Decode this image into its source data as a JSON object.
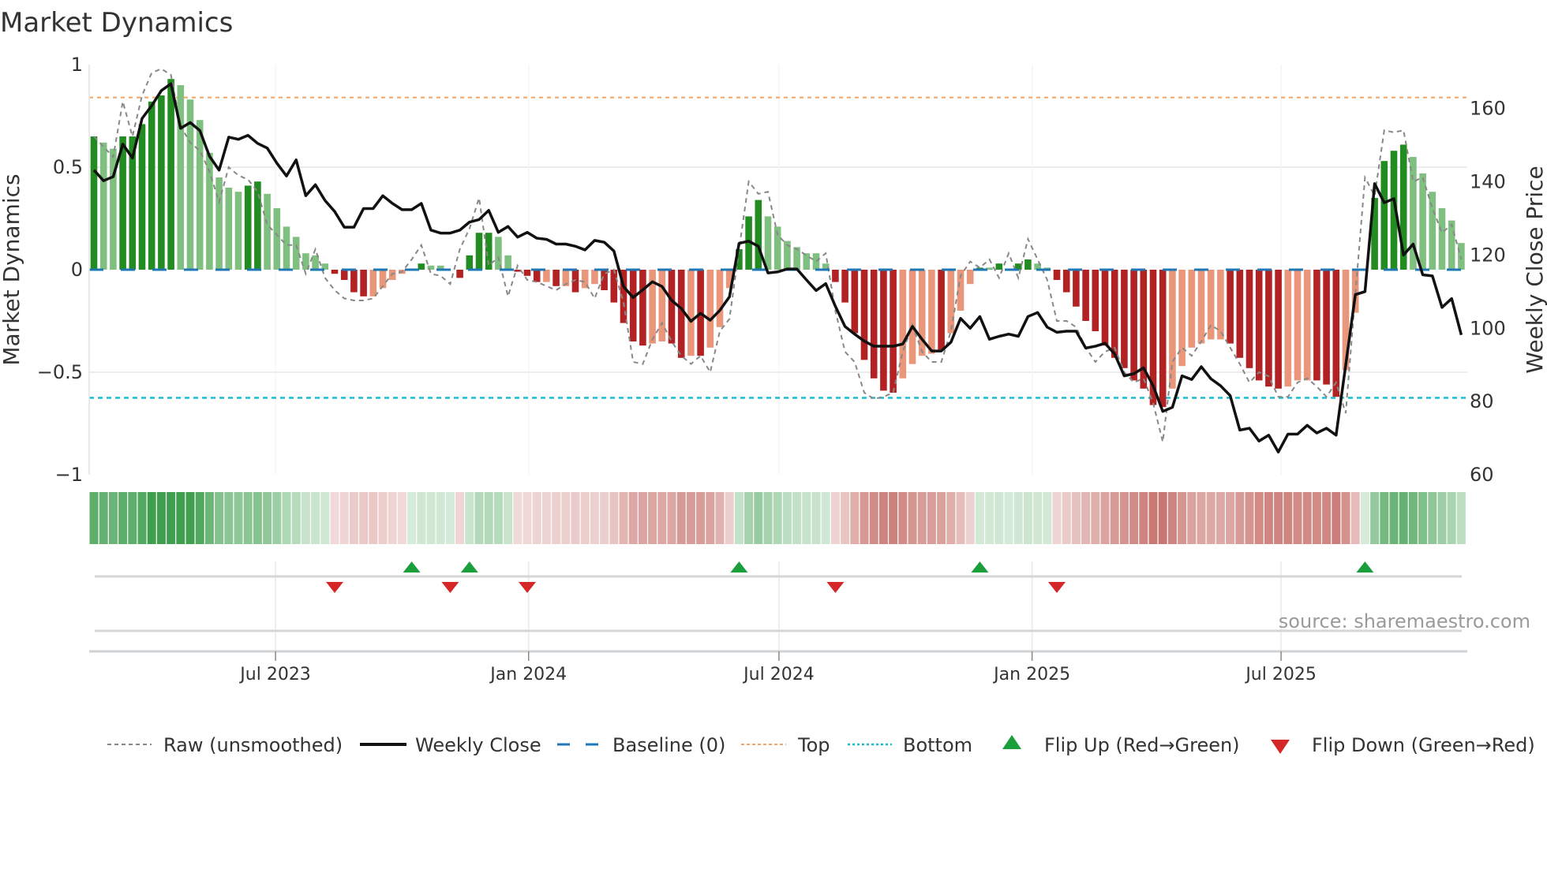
{
  "title": "Market Dynamics",
  "source": "source: sharemaestro.com",
  "chart_data": {
    "type": "bar",
    "title": "Market Dynamics",
    "ylabel": "Market Dynamics",
    "y2label": "Weekly Close Price",
    "ylim": [
      -1,
      1
    ],
    "y2lim": [
      60,
      172
    ],
    "yticks": [
      {
        "v": 1,
        "label": "1"
      },
      {
        "v": 0.5,
        "label": "0.5"
      },
      {
        "v": 0,
        "label": "0"
      },
      {
        "v": -0.5,
        "label": "−0.5"
      },
      {
        "v": -1,
        "label": "−1"
      }
    ],
    "y2ticks": [
      {
        "v": 160,
        "label": "160"
      },
      {
        "v": 140,
        "label": "140"
      },
      {
        "v": 120,
        "label": "120"
      },
      {
        "v": 100,
        "label": "100"
      },
      {
        "v": 80,
        "label": "80"
      },
      {
        "v": 60,
        "label": "60"
      }
    ],
    "x_start": "2023-02-19",
    "x_step_days": 7,
    "xticks": [
      {
        "date": "2023-07-01",
        "label": "Jul 2023"
      },
      {
        "date": "2024-01-01",
        "label": "Jan 2024"
      },
      {
        "date": "2024-07-01",
        "label": "Jul 2024"
      },
      {
        "date": "2025-01-01",
        "label": "Jan 2025"
      },
      {
        "date": "2025-07-01",
        "label": "Jul 2025"
      }
    ],
    "levels": {
      "baseline": 0,
      "top": 0.84,
      "bottom": -0.625
    },
    "series": [
      {
        "name": "Market Dynamics",
        "values": [
          0.65,
          0.62,
          0.59,
          0.65,
          0.65,
          0.71,
          0.82,
          0.85,
          0.93,
          0.9,
          0.83,
          0.73,
          0.57,
          0.45,
          0.4,
          0.38,
          0.41,
          0.43,
          0.37,
          0.3,
          0.21,
          0.16,
          0.08,
          0.07,
          0.03,
          -0.02,
          -0.05,
          -0.11,
          -0.13,
          -0.13,
          -0.09,
          -0.05,
          -0.02,
          0,
          0.03,
          0.02,
          0.02,
          0,
          -0.04,
          0.07,
          0.18,
          0.18,
          0.16,
          0.07,
          -0.01,
          -0.03,
          -0.06,
          -0.06,
          -0.08,
          -0.08,
          -0.11,
          -0.09,
          -0.07,
          -0.1,
          -0.16,
          -0.26,
          -0.35,
          -0.37,
          -0.36,
          -0.35,
          -0.36,
          -0.43,
          -0.42,
          -0.42,
          -0.38,
          -0.28,
          -0.09,
          0.1,
          0.26,
          0.34,
          0.26,
          0.21,
          0.14,
          0.11,
          0.08,
          0.08,
          0.03,
          -0.06,
          -0.16,
          -0.31,
          -0.44,
          -0.53,
          -0.59,
          -0.6,
          -0.53,
          -0.46,
          -0.42,
          -0.41,
          -0.39,
          -0.31,
          -0.2,
          -0.07,
          0.01,
          0.01,
          0.03,
          0,
          0.03,
          0.05,
          0.03,
          0.01,
          -0.05,
          -0.11,
          -0.18,
          -0.25,
          -0.3,
          -0.37,
          -0.43,
          -0.48,
          -0.54,
          -0.58,
          -0.66,
          -0.67,
          -0.58,
          -0.47,
          -0.38,
          -0.36,
          -0.34,
          -0.34,
          -0.36,
          -0.43,
          -0.48,
          -0.54,
          -0.57,
          -0.58,
          -0.57,
          -0.54,
          -0.54,
          -0.54,
          -0.56,
          -0.62,
          -0.49,
          -0.21,
          0,
          0.35,
          0.53,
          0.58,
          0.61,
          0.55,
          0.47,
          0.38,
          0.3,
          0.24,
          0.13
        ],
        "shade": "DLLDDDDDDLLLLLLLDDLLLLLLLDDDDLLLLLDLLLDDDDLLDDDLDLDLLDDDDDLLDDLDLLLDDDLLLLLLLDDDDDDDLLLLDLLLDLDLDDLLDDDDDDDDDDDDLLLLLLDDDDDDLLLDDDLLLDDDDLLLLLL"
      },
      {
        "name": "Raw (unsmoothed)",
        "values": [
          0.65,
          0.6,
          0.55,
          0.82,
          0.65,
          0.85,
          0.96,
          0.98,
          0.95,
          0.7,
          0.62,
          0.58,
          0.48,
          0.33,
          0.5,
          0.46,
          0.44,
          0.38,
          0.22,
          0.17,
          0.12,
          0.12,
          -0.02,
          0.1,
          -0.04,
          -0.1,
          -0.14,
          -0.15,
          -0.15,
          -0.14,
          -0.08,
          -0.02,
          -0.01,
          0.05,
          0.12,
          -0.02,
          -0.03,
          -0.07,
          0.1,
          0.2,
          0.35,
          0.02,
          0.06,
          -0.13,
          0.02,
          -0.05,
          -0.06,
          -0.08,
          -0.1,
          -0.07,
          -0.05,
          -0.06,
          -0.14,
          -0.02,
          0,
          -0.16,
          -0.45,
          -0.46,
          -0.34,
          -0.26,
          -0.35,
          -0.42,
          -0.46,
          -0.42,
          -0.5,
          -0.3,
          -0.24,
          0.1,
          0.43,
          0.37,
          0.38,
          0.17,
          0.12,
          0.1,
          0.07,
          0.04,
          0.08,
          -0.2,
          -0.4,
          -0.45,
          -0.6,
          -0.63,
          -0.62,
          -0.6,
          -0.4,
          -0.27,
          -0.4,
          -0.45,
          -0.45,
          -0.3,
          -0.03,
          0.04,
          0.01,
          0.05,
          -0.04,
          0.08,
          -0.04,
          0.15,
          0.05,
          -0.05,
          -0.25,
          -0.25,
          -0.28,
          -0.38,
          -0.45,
          -0.4,
          -0.38,
          -0.5,
          -0.55,
          -0.53,
          -0.65,
          -0.84,
          -0.45,
          -0.38,
          -0.42,
          -0.35,
          -0.27,
          -0.3,
          -0.38,
          -0.46,
          -0.55,
          -0.5,
          -0.52,
          -0.62,
          -0.62,
          -0.55,
          -0.53,
          -0.57,
          -0.62,
          -0.55,
          -0.7,
          -0.12,
          0.45,
          0.36,
          0.68,
          0.67,
          0.68,
          0.43,
          0.45,
          0.3,
          0.18,
          0.22,
          0.05
        ]
      },
      {
        "name": "Weekly Close",
        "axis": "right",
        "values": [
          143.2,
          140.3,
          141.4,
          150.3,
          146.5,
          157.3,
          160.8,
          164.9,
          166.8,
          154.6,
          156.2,
          154,
          147,
          143.2,
          152.2,
          151.6,
          152.7,
          150.5,
          149.2,
          145.1,
          141.6,
          146,
          136.2,
          139.2,
          134.9,
          131.9,
          127.6,
          127.6,
          132.7,
          132.7,
          136.2,
          134.1,
          132.4,
          132.4,
          134.1,
          126.8,
          126,
          126,
          126.8,
          129,
          129.7,
          132.2,
          126.2,
          127.8,
          124.9,
          126.2,
          124.6,
          124.3,
          123,
          123,
          122.4,
          121.4,
          124,
          123.5,
          121.1,
          111.4,
          108.4,
          110.5,
          112.7,
          111.4,
          107.6,
          105.4,
          101.9,
          104.1,
          102.2,
          104.9,
          108.6,
          123.2,
          123.8,
          122.4,
          115.1,
          115.4,
          116.2,
          116.2,
          113.2,
          110.3,
          112.2,
          106,
          100.5,
          98.4,
          96.5,
          95.1,
          95.1,
          95.1,
          95.7,
          100.5,
          97,
          93.8,
          93.8,
          96.2,
          102.7,
          100,
          103.2,
          97,
          97.8,
          98.4,
          97.8,
          103.2,
          104.3,
          100.3,
          98.9,
          99.2,
          99.2,
          94.6,
          95.1,
          95.9,
          93,
          87,
          87.6,
          89.2,
          84.3,
          77.3,
          78.4,
          87,
          86,
          89.5,
          86.2,
          84.3,
          81.6,
          72.2,
          72.7,
          69.2,
          70.8,
          66.2,
          71.1,
          71.1,
          73.5,
          71.4,
          72.7,
          70.8,
          90,
          109.2,
          110,
          139.5,
          134.3,
          135.4,
          120,
          123,
          114.6,
          114.3,
          105.7,
          108.1,
          98.2
        ]
      }
    ],
    "flips_up": [
      33,
      39,
      67,
      92,
      132
    ],
    "flips_down": [
      25,
      37,
      45,
      77,
      100
    ],
    "legend": {
      "position": "bottom",
      "raw": "Raw (unsmoothed)",
      "close": "Weekly Close",
      "baseline": "Baseline (0)",
      "top": "Top",
      "bottom": "Bottom",
      "flip_up": "Flip Up (Red→Green)",
      "flip_down": "Flip Down (Green→Red)"
    }
  },
  "colors": {
    "pos_dark": "#228b22",
    "pos_light": "#7fbf7f",
    "neg_dark": "#b22222",
    "neg_light": "#e9967a",
    "close": "#111111",
    "raw": "#888888",
    "baseline": "#1f77b4",
    "top": "#f4a460",
    "bottom": "#17becf",
    "flip_up": "#1a9f3c",
    "flip_down": "#d62728",
    "strip_pos": "#3f9f4f",
    "strip_neg": "#c0605a"
  }
}
